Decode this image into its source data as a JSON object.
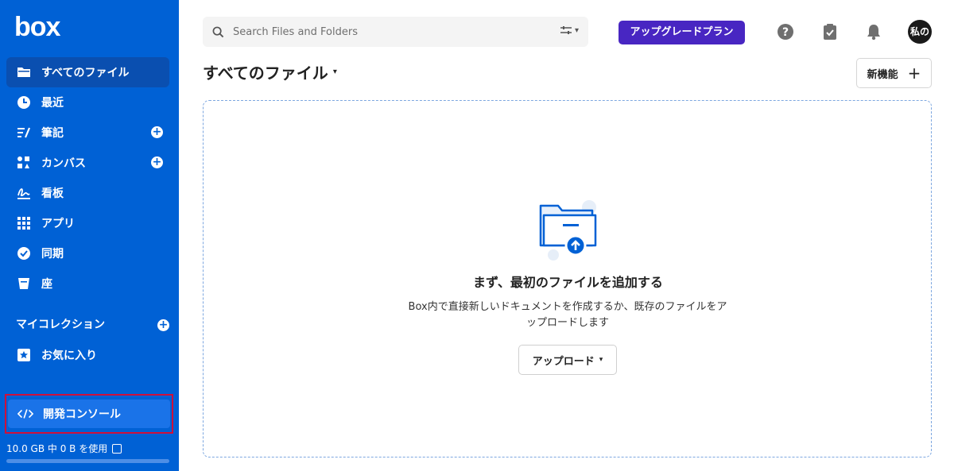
{
  "brand": {
    "logo_text": "box"
  },
  "sidebar": {
    "items": [
      {
        "label": "すべてのファイル",
        "icon": "folder-icon",
        "active": true,
        "has_add": false
      },
      {
        "label": "最近",
        "icon": "clock-icon",
        "active": false,
        "has_add": false
      },
      {
        "label": "筆記",
        "icon": "notes-icon",
        "active": false,
        "has_add": true
      },
      {
        "label": "カンバス",
        "icon": "canvas-icon",
        "active": false,
        "has_add": true
      },
      {
        "label": "看板",
        "icon": "sign-icon",
        "active": false,
        "has_add": false
      },
      {
        "label": "アプリ",
        "icon": "apps-grid-icon",
        "active": false,
        "has_add": false
      },
      {
        "label": "同期",
        "icon": "sync-check-icon",
        "active": false,
        "has_add": false
      },
      {
        "label": "座",
        "icon": "trash-icon",
        "active": false,
        "has_add": false
      }
    ],
    "collections_heading": "マイコレクション",
    "favorites_label": "お気に入り",
    "dev_console_label": "開発コンソール",
    "storage_text": "10.0 GB 中 0 B を使用",
    "storage_used_fraction": 0
  },
  "search": {
    "placeholder": "Search Files and Folders"
  },
  "header": {
    "upgrade_label": "アップグレードプラン",
    "avatar_text": "私の"
  },
  "page": {
    "title": "すべてのファイル",
    "new_label": "新機能",
    "empty_title": "まず、最初のファイルを追加する",
    "empty_desc_line1": "Box内で直接新しいドキュメントを作成するか、既存のファイルをア",
    "empty_desc_line2": "ップロードします",
    "upload_label": "アップロード"
  },
  "colors": {
    "sidebar_bg": "#0061d5",
    "active_item_bg": "#0a4fb0",
    "upgrade_bg": "#4826c2",
    "highlight_border": "#d0103a"
  }
}
